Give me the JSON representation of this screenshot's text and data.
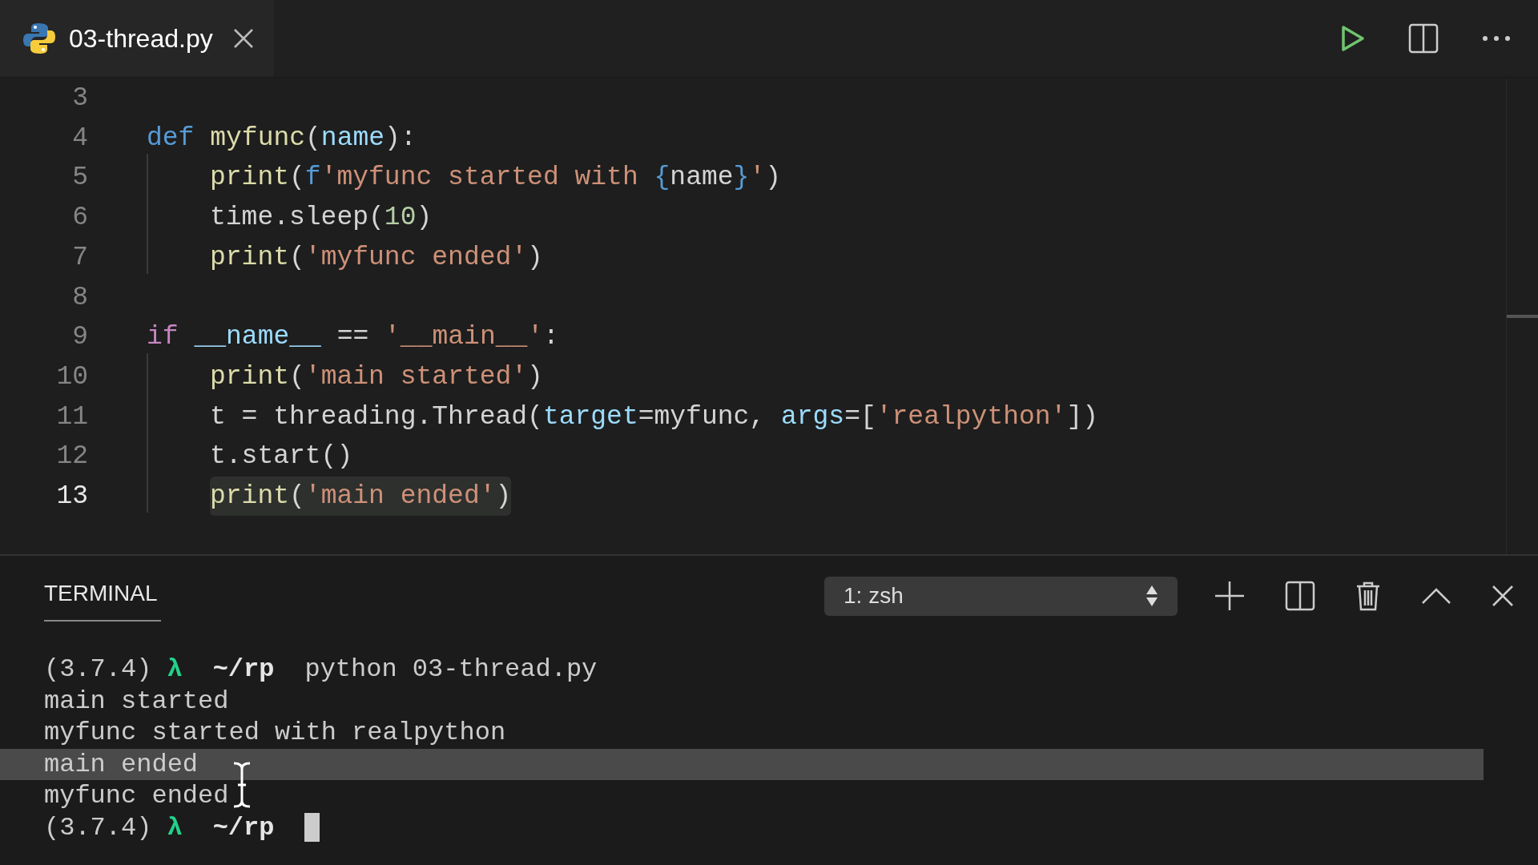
{
  "tab": {
    "title": "03-thread.py",
    "selected": true
  },
  "editor": {
    "lines": [
      {
        "number": "3",
        "current": false,
        "indented": false
      },
      {
        "number": "4",
        "current": false,
        "indented": false,
        "tokens": [
          {
            "kind": "keyword",
            "text": "def"
          },
          {
            "kind": "function",
            "text": " myfunc"
          },
          {
            "kind": "plain",
            "text": "("
          },
          {
            "kind": "param",
            "text": "name"
          },
          {
            "kind": "plain",
            "text": "):"
          }
        ]
      },
      {
        "number": "5",
        "current": false,
        "indented": true,
        "tokens": [
          {
            "kind": "function",
            "text": "print"
          },
          {
            "kind": "plain",
            "text": "("
          },
          {
            "kind": "keyword",
            "text": "f"
          },
          {
            "kind": "string",
            "text": "'myfunc started with "
          },
          {
            "kind": "keyword",
            "text": "{"
          },
          {
            "kind": "plain",
            "text": "name"
          },
          {
            "kind": "keyword",
            "text": "}"
          },
          {
            "kind": "string",
            "text": "'"
          },
          {
            "kind": "plain",
            "text": ")"
          }
        ]
      },
      {
        "number": "6",
        "current": false,
        "indented": true,
        "tokens": [
          {
            "kind": "plain",
            "text": "time.sleep("
          },
          {
            "kind": "number",
            "text": "10"
          },
          {
            "kind": "plain",
            "text": ")"
          }
        ]
      },
      {
        "number": "7",
        "current": false,
        "indented": true,
        "tokens": [
          {
            "kind": "function",
            "text": "print"
          },
          {
            "kind": "plain",
            "text": "("
          },
          {
            "kind": "string",
            "text": "'myfunc ended'"
          },
          {
            "kind": "plain",
            "text": ")"
          }
        ]
      },
      {
        "number": "8",
        "current": false,
        "indented": false
      },
      {
        "number": "9",
        "current": false,
        "indented": false,
        "tokens": [
          {
            "kind": "control",
            "text": "if"
          },
          {
            "kind": "param",
            "text": " __name__"
          },
          {
            "kind": "plain",
            "text": " == "
          },
          {
            "kind": "string",
            "text": "'__main__'"
          },
          {
            "kind": "plain",
            "text": ":"
          }
        ]
      },
      {
        "number": "10",
        "current": false,
        "indented": true,
        "tokens": [
          {
            "kind": "function",
            "text": "print"
          },
          {
            "kind": "plain",
            "text": "("
          },
          {
            "kind": "string",
            "text": "'main started'"
          },
          {
            "kind": "plain",
            "text": ")"
          }
        ]
      },
      {
        "number": "11",
        "current": false,
        "indented": true,
        "tokens": [
          {
            "kind": "plain",
            "text": "t = threading.Thread("
          },
          {
            "kind": "param",
            "text": "target"
          },
          {
            "kind": "plain",
            "text": "=myfunc, "
          },
          {
            "kind": "param",
            "text": "args"
          },
          {
            "kind": "plain",
            "text": "=["
          },
          {
            "kind": "string",
            "text": "'realpython'"
          },
          {
            "kind": "plain",
            "text": "])"
          }
        ]
      },
      {
        "number": "12",
        "current": false,
        "indented": true,
        "tokens": [
          {
            "kind": "plain",
            "text": "t.start()"
          }
        ]
      },
      {
        "number": "13",
        "current": true,
        "indented": true,
        "tokens": [
          {
            "kind": "function",
            "text": "print"
          },
          {
            "kind": "plain",
            "text": "("
          },
          {
            "kind": "string",
            "text": "'main ended'"
          },
          {
            "kind": "plain",
            "text": ")"
          }
        ]
      }
    ]
  },
  "panel": {
    "tab": {
      "label": "TERMINAL",
      "selected": true
    },
    "shell_select": {
      "value": "1: zsh"
    }
  },
  "terminal": {
    "lines": [
      {
        "selected": false,
        "tokens": [
          {
            "kind": "version",
            "text": "(3.7.4)"
          },
          {
            "kind": "lambda",
            "text": "λ"
          },
          {
            "kind": "path",
            "text": "~/rp"
          },
          {
            "kind": "command",
            "text": "python 03-thread.py"
          }
        ]
      },
      {
        "selected": false,
        "tokens": [
          {
            "kind": "output",
            "text": "main started"
          }
        ]
      },
      {
        "selected": false,
        "tokens": [
          {
            "kind": "output",
            "text": "myfunc started with realpython"
          }
        ]
      },
      {
        "selected": true,
        "tokens": [
          {
            "kind": "output",
            "text": "main ended"
          }
        ]
      },
      {
        "selected": false,
        "tokens": [
          {
            "kind": "output",
            "text": "myfunc ended"
          }
        ]
      },
      {
        "selected": false,
        "cursor": true,
        "tokens": [
          {
            "kind": "version",
            "text": "(3.7.4)"
          },
          {
            "kind": "lambda",
            "text": "λ"
          },
          {
            "kind": "path",
            "text": "~/rp"
          }
        ]
      }
    ]
  }
}
